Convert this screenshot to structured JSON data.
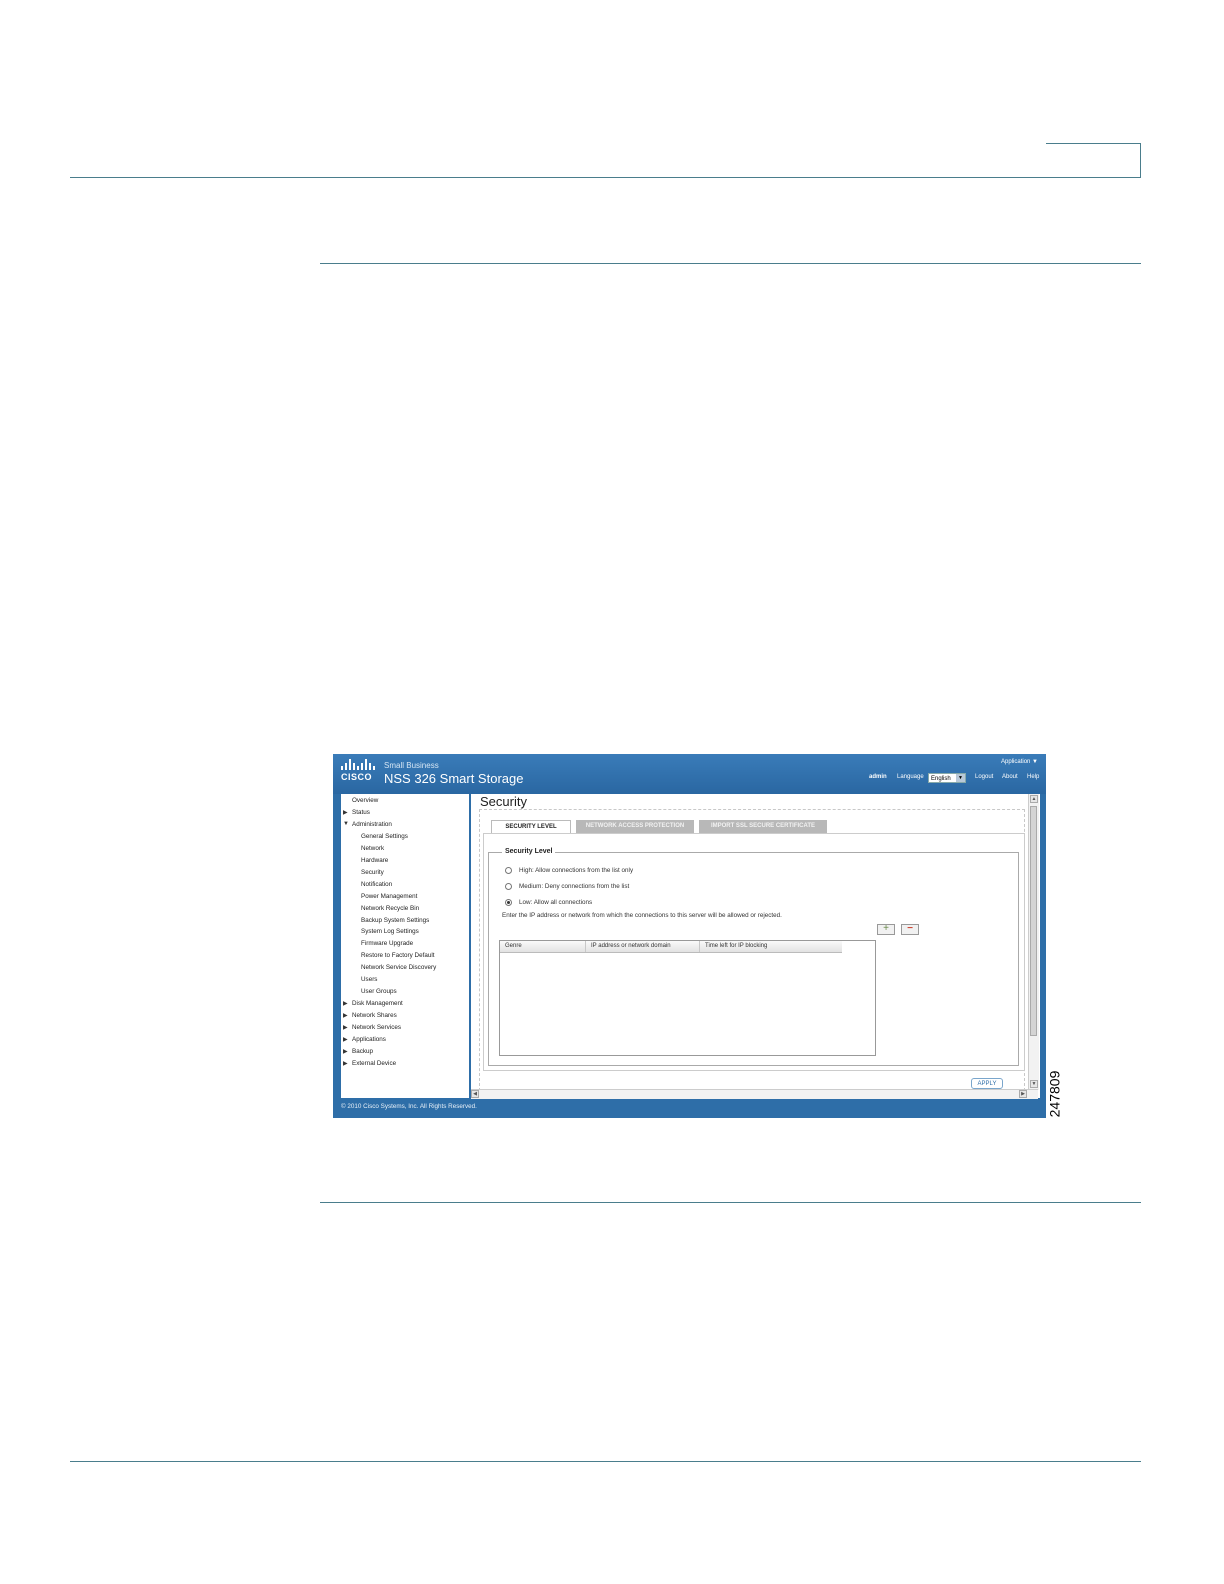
{
  "screenshot": {
    "brand": {
      "logo_text": "CISCO",
      "small_label": "Small Business",
      "title": "NSS 326 Smart Storage"
    },
    "header": {
      "application_menu": "Application ▼",
      "user": "admin",
      "language_label": "Language",
      "language_value": "English",
      "logout": "Logout",
      "about": "About",
      "help": "Help"
    },
    "sidebar": {
      "items": [
        {
          "label": "Overview",
          "arrow": ""
        },
        {
          "label": "Status",
          "arrow": "right"
        },
        {
          "label": "Administration",
          "arrow": "down"
        },
        {
          "label": "General Settings",
          "arrow": "",
          "sub": true
        },
        {
          "label": "Network",
          "arrow": "",
          "sub": true
        },
        {
          "label": "Hardware",
          "arrow": "",
          "sub": true
        },
        {
          "label": "Security",
          "arrow": "",
          "sub": true
        },
        {
          "label": "Notification",
          "arrow": "",
          "sub": true
        },
        {
          "label": "Power Management",
          "arrow": "",
          "sub": true
        },
        {
          "label": "Network Recycle Bin",
          "arrow": "",
          "sub": true
        },
        {
          "label": "Backup System Settings",
          "arrow": "",
          "sub": true
        },
        {
          "label": "System Log Settings",
          "arrow": "",
          "sub": true
        },
        {
          "label": "Firmware Upgrade",
          "arrow": "",
          "sub": true
        },
        {
          "label": "Restore to Factory Default",
          "arrow": "",
          "sub": true
        },
        {
          "label": "Network Service Discovery",
          "arrow": "",
          "sub": true
        },
        {
          "label": "Users",
          "arrow": "",
          "sub": true
        },
        {
          "label": "User Groups",
          "arrow": "",
          "sub": true
        },
        {
          "label": "Disk Management",
          "arrow": "right"
        },
        {
          "label": "Network Shares",
          "arrow": "right"
        },
        {
          "label": "Network Services",
          "arrow": "right"
        },
        {
          "label": "Applications",
          "arrow": "right"
        },
        {
          "label": "Backup",
          "arrow": "right"
        },
        {
          "label": "External Device",
          "arrow": "right"
        }
      ]
    },
    "content": {
      "title": "Security",
      "tabs": [
        {
          "label": "SECURITY LEVEL",
          "active": true
        },
        {
          "label": "NETWORK ACCESS PROTECTION",
          "active": false
        },
        {
          "label": "IMPORT SSL SECURE CERTIFICATE",
          "active": false
        }
      ],
      "fieldset_legend": "Security Level",
      "options": [
        {
          "label": "High: Allow connections from the list only",
          "checked": false
        },
        {
          "label": "Medium: Deny connections from the list",
          "checked": false
        },
        {
          "label": "Low: Allow all connections",
          "checked": true
        }
      ],
      "instruction": "Enter the IP address or network from which the connections to this server will be allowed or rejected.",
      "add_icon": "plus-icon",
      "remove_icon": "minus-icon",
      "table_headers": [
        "Genre",
        "IP address or network domain",
        "Time left for IP blocking"
      ],
      "apply_label": "APPLY"
    },
    "footer": "© 2010 Cisco Systems, Inc. All Rights Reserved."
  },
  "figure_number": "247809",
  "colors": {
    "rule": "#4a7d8c",
    "banner": "#2e6ea8",
    "tab_inactive": "#b8b8b8"
  }
}
